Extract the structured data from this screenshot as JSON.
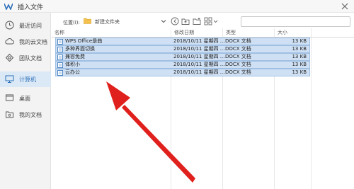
{
  "window": {
    "title": "插入文件"
  },
  "sidebar": {
    "items": [
      {
        "label": "最近访问",
        "icon": "clock-icon",
        "active": false
      },
      {
        "label": "我的云文档",
        "icon": "cloud-icon",
        "active": false
      },
      {
        "label": "团队文档",
        "icon": "team-icon",
        "active": false
      },
      {
        "label": "计算机",
        "icon": "computer-icon",
        "active": true
      },
      {
        "label": "桌面",
        "icon": "desktop-icon",
        "active": false
      },
      {
        "label": "我的文档",
        "icon": "document-icon",
        "active": false
      }
    ]
  },
  "toolbar": {
    "location_label": "位置(I):",
    "location_value": "新建文件夹",
    "search_placeholder": ""
  },
  "table": {
    "columns": [
      "名称",
      "修改日期",
      "类型",
      "大小"
    ],
    "rows": [
      {
        "name": "WPS Office是曲",
        "date": "2018/10/11 星期四 ...",
        "type": "DOCX 文档",
        "size": "13 KB"
      },
      {
        "name": "多种界面切换",
        "date": "2018/10/11 星期四 ...",
        "type": "DOCX 文档",
        "size": "13 KB"
      },
      {
        "name": "兼容免费",
        "date": "2018/10/11 星期四 ...",
        "type": "DOCX 文档",
        "size": "13 KB"
      },
      {
        "name": "体积小",
        "date": "2018/10/11 星期四 ...",
        "type": "DOCX 文档",
        "size": "13 KB"
      },
      {
        "name": "云办公",
        "date": "2018/10/11 星期四 ...",
        "type": "DOCX 文档",
        "size": "13 KB"
      }
    ]
  },
  "colors": {
    "selection": "#cfe0f4",
    "accent": "#2b6fb8",
    "arrow": "#e0201c"
  }
}
